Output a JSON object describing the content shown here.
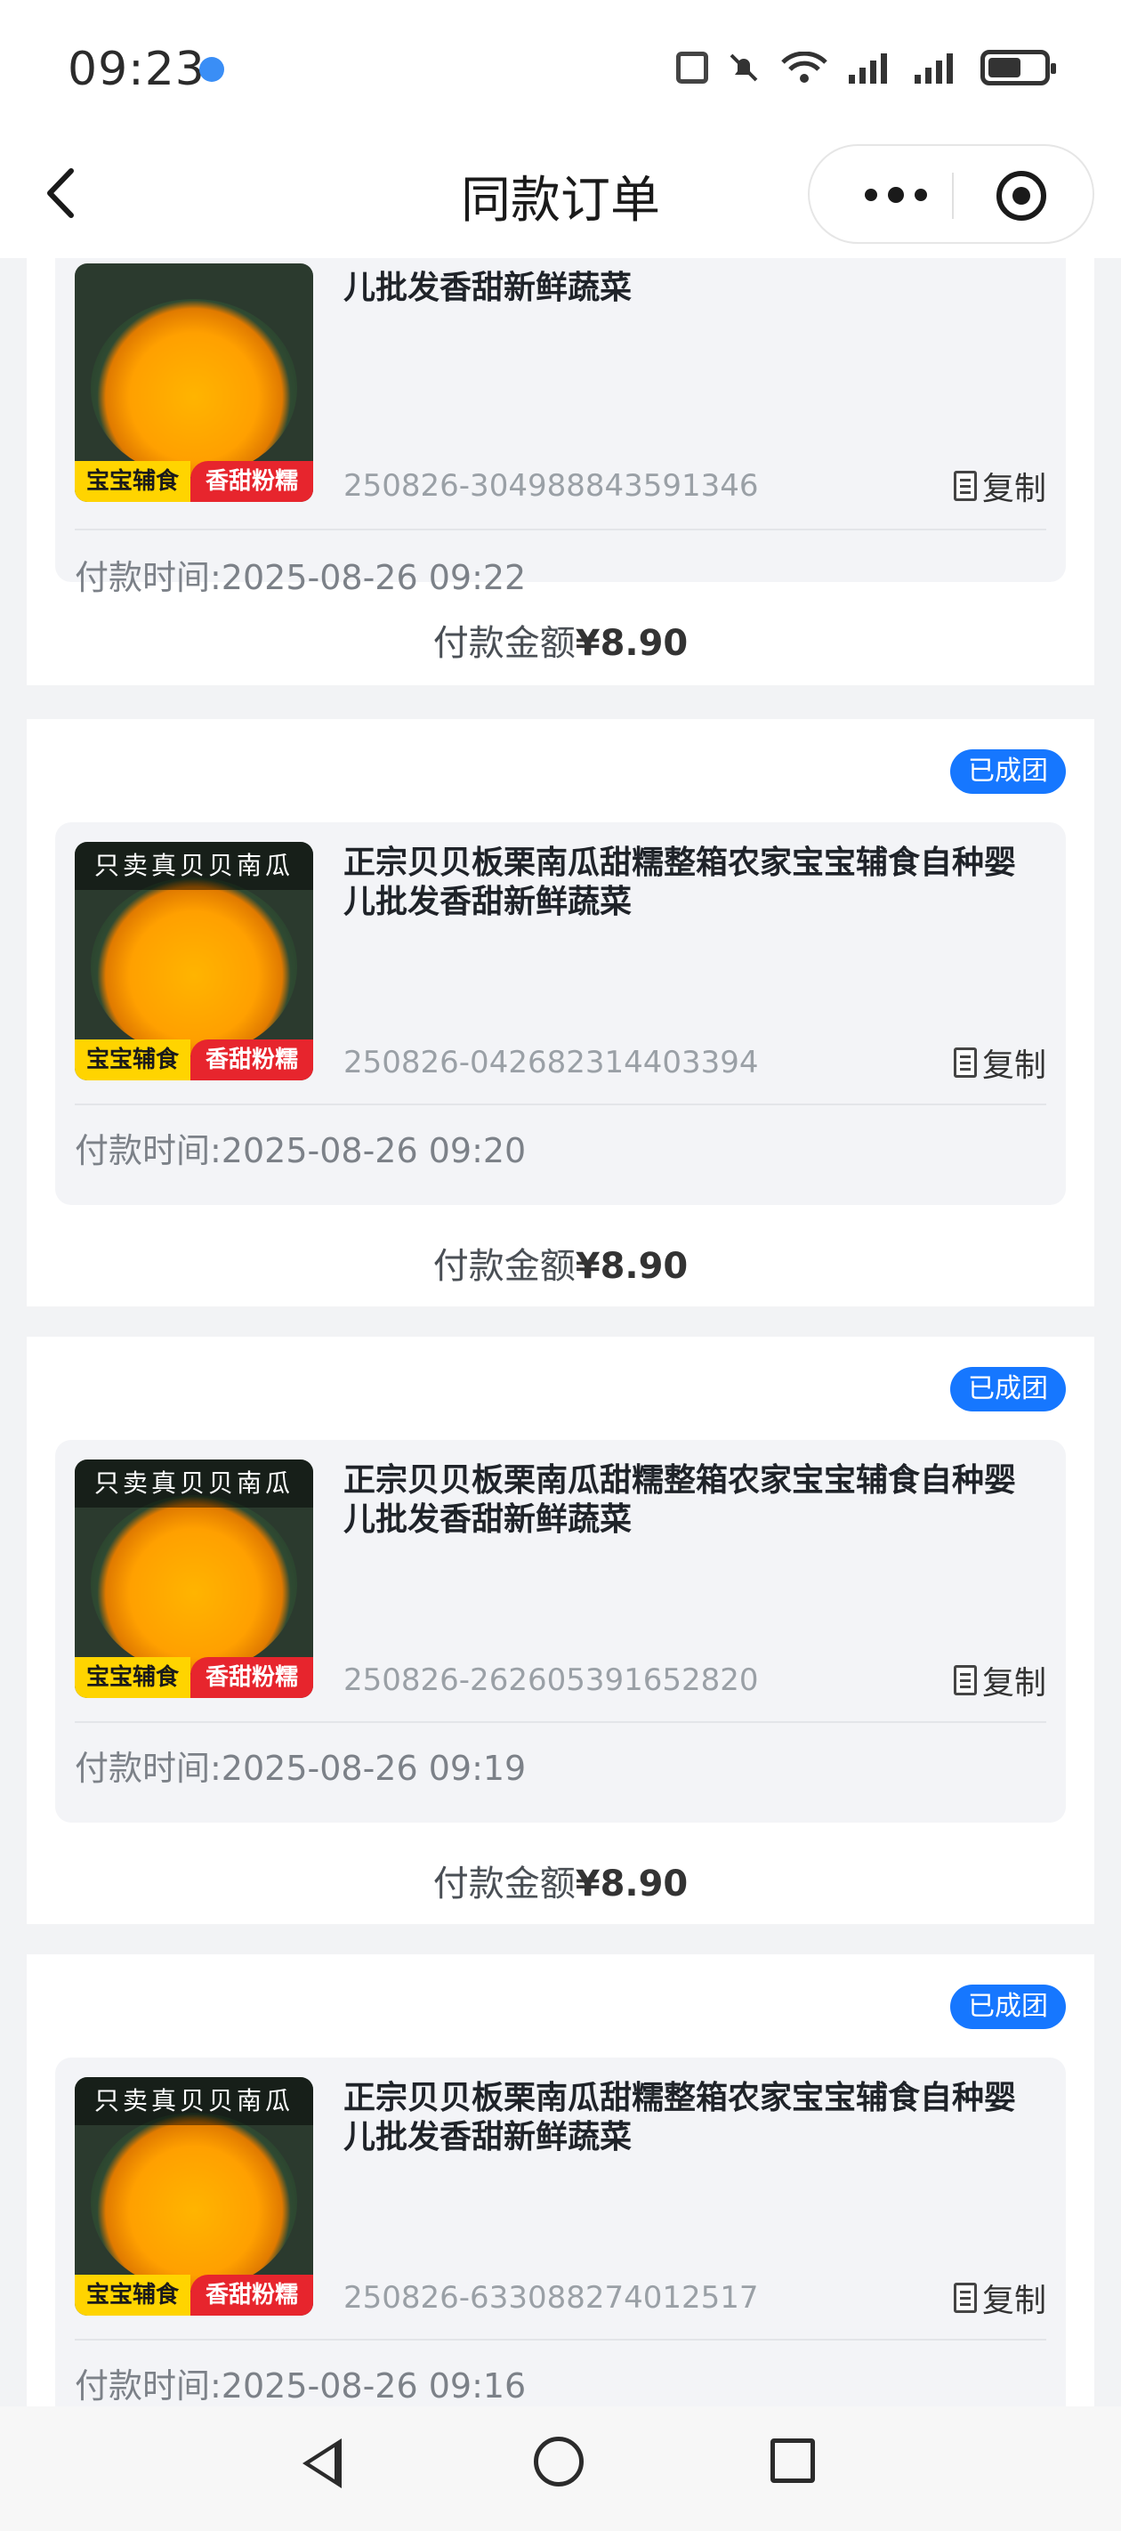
{
  "status_bar": {
    "time": "09:23",
    "icons": [
      "location-dot-icon",
      "nfc-icon",
      "mute-bell-icon",
      "wifi-6-icon",
      "signal-1-icon",
      "signal-2-icon",
      "battery-icon"
    ]
  },
  "nav": {
    "title": "同款订单",
    "back_icon": "chevron-left-icon",
    "more_icon": "more-dots-icon",
    "close_icon": "target-circle-icon"
  },
  "orders": [
    {
      "badge": "",
      "product_title": "儿批发香甜新鲜蔬菜",
      "image_banner": "",
      "image_tag_left": "宝宝辅食",
      "image_tag_right": "香甜粉糯",
      "order_no": "250826-304988843591346",
      "copy_label": "复制",
      "pay_time": "付款时间:2025-08-26 09:22",
      "amount_label": "付款金额",
      "amount_value": "¥8.90"
    },
    {
      "badge": "已成团",
      "product_title": "正宗贝贝板栗南瓜甜糯整箱农家宝宝辅食自种婴儿批发香甜新鲜蔬菜",
      "image_banner": "只卖真贝贝南瓜",
      "image_tag_left": "宝宝辅食",
      "image_tag_right": "香甜粉糯",
      "order_no": "250826-042682314403394",
      "copy_label": "复制",
      "pay_time": "付款时间:2025-08-26 09:20",
      "amount_label": "付款金额",
      "amount_value": "¥8.90"
    },
    {
      "badge": "已成团",
      "product_title": "正宗贝贝板栗南瓜甜糯整箱农家宝宝辅食自种婴儿批发香甜新鲜蔬菜",
      "image_banner": "只卖真贝贝南瓜",
      "image_tag_left": "宝宝辅食",
      "image_tag_right": "香甜粉糯",
      "order_no": "250826-262605391652820",
      "copy_label": "复制",
      "pay_time": "付款时间:2025-08-26 09:19",
      "amount_label": "付款金额",
      "amount_value": "¥8.90"
    },
    {
      "badge": "已成团",
      "product_title": "正宗贝贝板栗南瓜甜糯整箱农家宝宝辅食自种婴儿批发香甜新鲜蔬菜",
      "image_banner": "只卖真贝贝南瓜",
      "image_tag_left": "宝宝辅食",
      "image_tag_right": "香甜粉糯",
      "order_no": "250826-633088274012517",
      "copy_label": "复制",
      "pay_time": "付款时间:2025-08-26 09:16",
      "amount_label": "",
      "amount_value": ""
    }
  ],
  "system_nav": {
    "icons": [
      "nav-back-triangle-icon",
      "nav-home-circle-icon",
      "nav-recent-square-icon"
    ]
  },
  "colors": {
    "badge_blue": "#1677ff",
    "page_bg": "#f2f3f5",
    "card_inner_bg": "#f3f4f7",
    "tag_yellow": "#ffd400",
    "tag_red": "#e7252d"
  }
}
